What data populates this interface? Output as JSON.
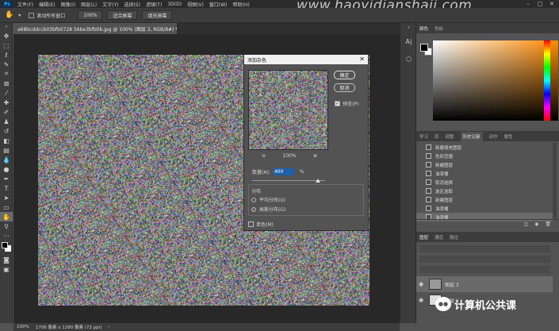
{
  "menubar": {
    "logo": "Ps",
    "items": [
      "文件(F)",
      "编辑(E)",
      "图像(I)",
      "图层(L)",
      "文字(Y)",
      "选择(S)",
      "滤镜(T)",
      "3D(D)",
      "视图(V)",
      "窗口(W)",
      "帮助(H)"
    ],
    "watermark": "www.haoyidianshaji.com"
  },
  "options": {
    "scroll_all": "滚动所有窗口",
    "zoom": "100%",
    "fit_screen": "适合屏幕",
    "fill_screen": "填充屏幕"
  },
  "document": {
    "tab": "a68bcddccb03bfb0728 56be3bfb0b.jpg @ 100% (图层 3, RGB/8#) *",
    "status_zoom": "100%",
    "status_size": "1706 像素 x 1280 像素 (72 ppi)"
  },
  "dialog": {
    "title": "添加杂色",
    "ok": "确定",
    "cancel": "取消",
    "preview": "预览(P)",
    "zoom_level": "100%",
    "amount_label": "数量(A):",
    "amount_value": "400",
    "amount_unit": "%",
    "distribution_label": "分布",
    "uniform": "平均分布(U)",
    "gaussian": "高斯分布(G)",
    "monochromatic": "单色(M)",
    "amount_fraction": 0.4
  },
  "color_panel": {
    "tabs": [
      "颜色",
      "色板"
    ],
    "hue_color": "#ff8a00"
  },
  "history_panel": {
    "tabs": [
      "学习",
      "库",
      "调整",
      "历史记录",
      "动作",
      "属性"
    ],
    "items": [
      "新建填充图层",
      "色彩范围",
      "新建图层",
      "油漆桶",
      "取消选择",
      "选区选取",
      "新建图层",
      "油漆桶",
      "油漆桶"
    ],
    "active_index": 8
  },
  "layers_panel": {
    "tabs": [
      "图层",
      "通道",
      "路径"
    ],
    "layers": [
      "图层 3",
      "图层 2"
    ]
  },
  "watermark_badge": {
    "text": "计算机公共课"
  }
}
